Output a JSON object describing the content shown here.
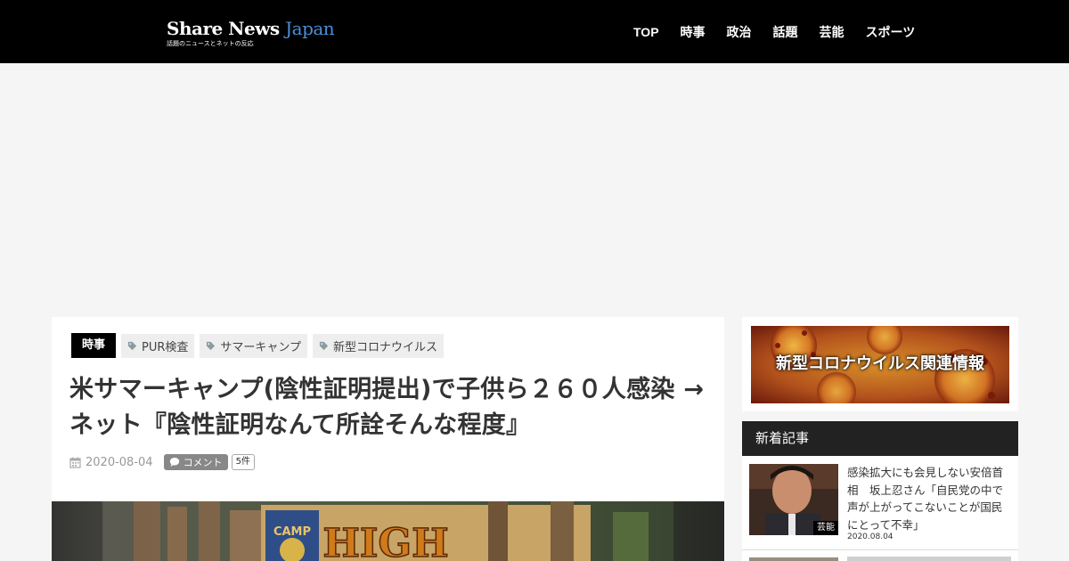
{
  "header": {
    "logo_main": "Share News ",
    "logo_accent": "Japan",
    "logo_sub": "話題のニュースとネットの反応",
    "nav": [
      "TOP",
      "時事",
      "政治",
      "話題",
      "芸能",
      "スポーツ"
    ]
  },
  "article": {
    "category": "時事",
    "tags": [
      "PUR検査",
      "サマーキャンプ",
      "新型コロナウイルス"
    ],
    "title": "米サマーキャンプ(陰性証明提出)で子供ら２６０人感染 → ネット『陰性証明なんて所詮そんな程度』",
    "date": "2020-08-04",
    "comment_label": "コメント",
    "comment_count": "5件",
    "hero_image_text": "CAMP HIGH"
  },
  "sidebar": {
    "banner_text": "新型コロナウイルス関連情報",
    "new_posts_heading": "新着記事",
    "posts": [
      {
        "title": "感染拡大にも会見しない安倍首相　坂上忍さん「自民党の中で声が上がってこないことが国民にとって不幸」",
        "date": "2020.08.04",
        "category": "芸能"
      }
    ]
  },
  "colors": {
    "header_bg": "#000000",
    "logo_accent": "#4a8fd8",
    "page_bg": "#f5f5f5",
    "sidebar_header_bg": "#222222"
  },
  "icons": {
    "tag": "tag-icon",
    "date": "calendar-icon",
    "comment": "speech-bubble-icon"
  }
}
